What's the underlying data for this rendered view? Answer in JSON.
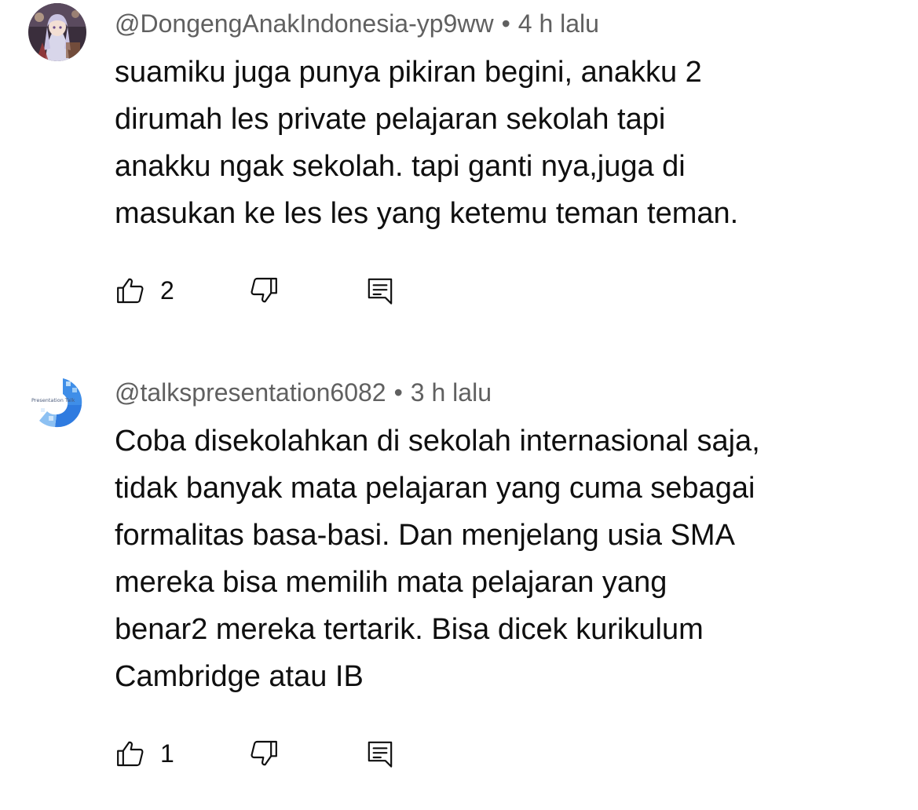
{
  "comments": [
    {
      "author": "@DongengAnakIndonesia-yp9ww",
      "separator": "•",
      "time": "4 h lalu",
      "lines": [
        "suamiku juga punya pikiran begini, anakku 2",
        "dirumah les private pelajaran sekolah tapi",
        "anakku ngak sekolah. tapi ganti nya,juga di",
        "masukan ke les les yang ketemu teman teman."
      ],
      "likes": "2",
      "avatar_icon": "anime-girl-avatar"
    },
    {
      "author": "@talkspresentation6082",
      "separator": "•",
      "time": "3 h lalu",
      "lines": [
        "Coba disekolahkan di sekolah internasional saja,",
        "tidak banyak mata pelajaran yang cuma sebagai",
        "formalitas basa-basi. Dan menjelang usia SMA",
        "mereka bisa memilih mata pelajaran yang",
        "benar2 mereka tertarik. Bisa dicek kurikulum",
        "Cambridge atau IB"
      ],
      "likes": "1",
      "avatar_icon": "presentation-logo-avatar",
      "avatar_text": "Presentation Talk"
    }
  ],
  "icons": {
    "like": "thumbs-up-icon",
    "dislike": "thumbs-down-icon",
    "reply": "reply-comment-icon"
  },
  "colors": {
    "meta": "#606060",
    "text": "#0f0f0f",
    "background": "#ffffff"
  }
}
